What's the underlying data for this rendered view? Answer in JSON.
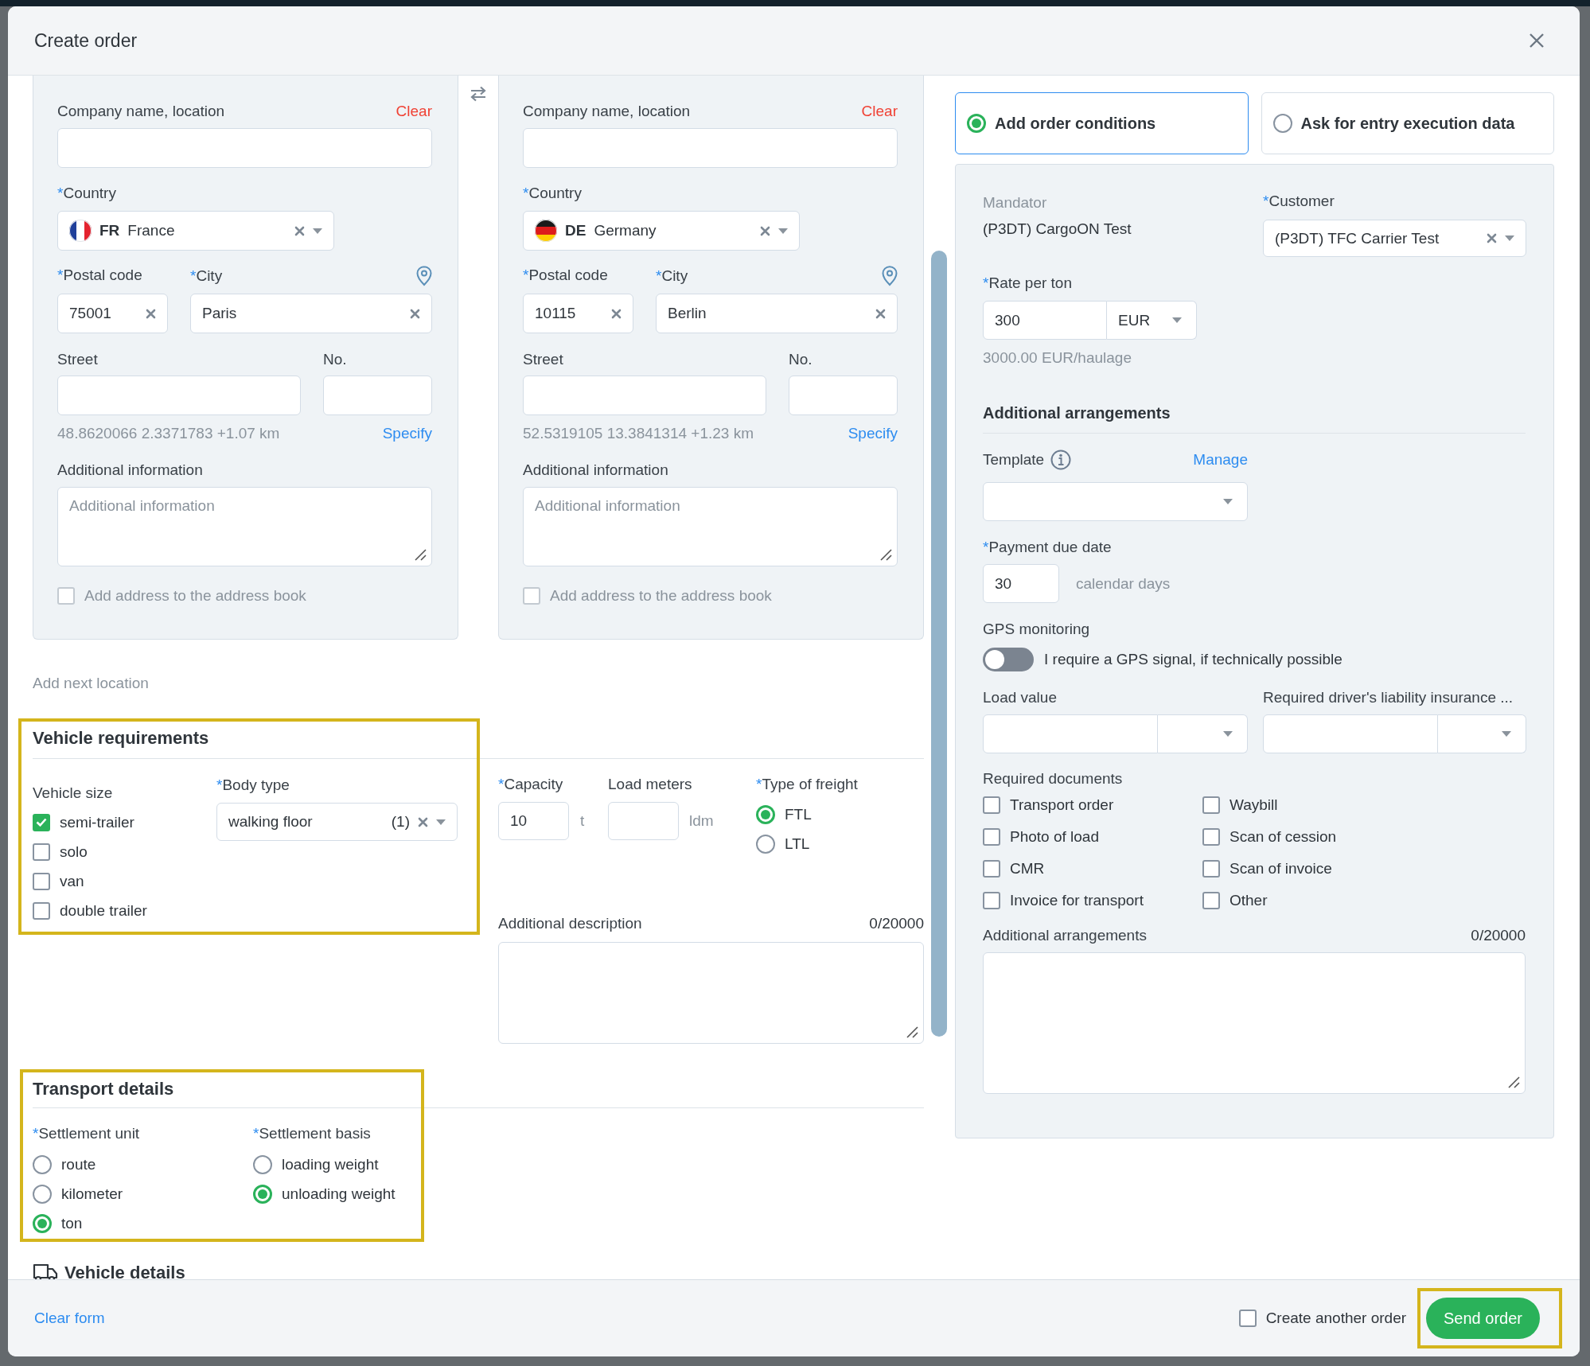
{
  "window": {
    "title": "Create order"
  },
  "locations": [
    {
      "company_label": "Company name, location",
      "clear": "Clear",
      "country_label": {
        "mark": "*",
        "text": "Country"
      },
      "flag": {
        "kind": "fr"
      },
      "country_code": "FR",
      "country": "France",
      "postal_label": {
        "mark": "*",
        "text": "Postal code"
      },
      "postal_code": "75001",
      "city_label": {
        "mark": "*",
        "text": "City"
      },
      "city": "Paris",
      "street_label": "Street",
      "number_label": "No.",
      "coordinates": "48.8620066 2.3371783 +1.07 km",
      "specify": "Specify",
      "info_label": "Additional information",
      "info_placeholder": "Additional information",
      "address_book": {
        "label": "Add address to the address book",
        "checked": false,
        "disabled": true
      }
    },
    {
      "company_label": "Company name, location",
      "clear": "Clear",
      "country_label": {
        "mark": "*",
        "text": "Country"
      },
      "flag": {
        "kind": "de"
      },
      "country_code": "DE",
      "country": "Germany",
      "postal_label": {
        "mark": "*",
        "text": "Postal code"
      },
      "postal_code": "10115",
      "city_label": {
        "mark": "*",
        "text": "City"
      },
      "city": "Berlin",
      "street_label": "Street",
      "number_label": "No.",
      "coordinates": "52.5319105 13.3841314 +1.23 km",
      "specify": "Specify",
      "info_label": "Additional information",
      "info_placeholder": "Additional information",
      "address_book": {
        "label": "Add address to the address book",
        "checked": false,
        "disabled": true
      }
    }
  ],
  "add_next_location": "Add next location",
  "vehicle_requirements": {
    "title": "Vehicle requirements",
    "highlighted": true,
    "size_label": "Vehicle size",
    "sizes": [
      {
        "label": "semi-trailer",
        "checked": true
      },
      {
        "label": "solo",
        "checked": false
      },
      {
        "label": "van",
        "checked": false
      },
      {
        "label": "double trailer",
        "checked": false
      }
    ],
    "body_type_label": {
      "mark": "*",
      "text": "Body type"
    },
    "body_type": "walking floor",
    "body_type_count": "(1)",
    "capacity_label": {
      "mark": "*",
      "text": "Capacity"
    },
    "capacity": "10",
    "capacity_unit": "t",
    "load_meters_label": "Load meters",
    "load_meters_unit": "ldm",
    "freight_label": {
      "mark": "*",
      "text": "Type of freight"
    },
    "freight": [
      {
        "label": "FTL",
        "selected": true
      },
      {
        "label": "LTL",
        "selected": false
      }
    ],
    "description_label": "Additional description",
    "description_counter": "0/20000"
  },
  "transport_details": {
    "title": "Transport details",
    "highlighted": true,
    "unit_label": {
      "mark": "*",
      "text": "Settlement unit"
    },
    "units": [
      {
        "label": "route",
        "selected": false
      },
      {
        "label": "kilometer",
        "selected": false
      },
      {
        "label": "ton",
        "selected": true
      }
    ],
    "basis_label": {
      "mark": "*",
      "text": "Settlement basis"
    },
    "bases": [
      {
        "label": "loading weight",
        "selected": false
      },
      {
        "label": "unloading weight",
        "selected": true
      }
    ]
  },
  "vehicle_details": {
    "title": "Vehicle details"
  },
  "condition_tabs": [
    {
      "label": "Add order conditions",
      "selected": true
    },
    {
      "label": "Ask for entry execution data",
      "selected": false
    }
  ],
  "conditions": {
    "mandator_label": "Mandator",
    "mandator": "(P3DT) CargoON Test",
    "customer_label": {
      "mark": "*",
      "text": "Customer"
    },
    "customer": "(P3DT) TFC Carrier Test",
    "rate_label": {
      "mark": "*",
      "text": "Rate per ton"
    },
    "rate": "300",
    "currency": "EUR",
    "rate_total": "3000.00 EUR/haulage",
    "arrangements_title": "Additional arrangements",
    "template_label": "Template",
    "manage": "Manage",
    "payment_label": {
      "mark": "*",
      "text": "Payment due date"
    },
    "payment_days": "30",
    "payment_unit": "calendar days",
    "gps_label": "GPS monitoring",
    "gps": {
      "label": "I require a GPS signal, if technically possible",
      "on": false
    },
    "load_value_label": "Load value",
    "insurance_label": "Required driver's liability insurance ...",
    "documents_label": "Required documents",
    "documents": [
      {
        "label": "Transport order",
        "checked": false
      },
      {
        "label": "Waybill",
        "checked": false
      },
      {
        "label": "Photo of load",
        "checked": false
      },
      {
        "label": "Scan of cession",
        "checked": false
      },
      {
        "label": "CMR",
        "checked": false
      },
      {
        "label": "Scan of invoice",
        "checked": false
      },
      {
        "label": "Invoice for transport",
        "checked": false
      },
      {
        "label": "Other",
        "checked": false
      }
    ],
    "arrangements_label": "Additional arrangements",
    "arrangements_counter": "0/20000"
  },
  "footer": {
    "clear_form": "Clear form",
    "create_another": {
      "label": "Create another order",
      "checked": false
    },
    "send": {
      "label": "Send order",
      "highlighted": true
    }
  }
}
